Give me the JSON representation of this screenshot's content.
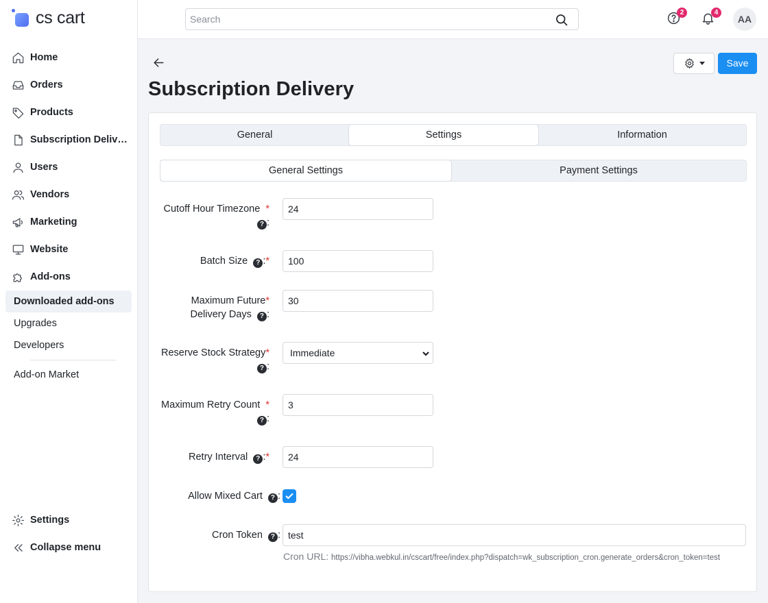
{
  "brand": {
    "name": "cs cart"
  },
  "search": {
    "placeholder": "Search"
  },
  "topbar": {
    "help_badge": "2",
    "notif_badge": "4",
    "avatar_initials": "AA"
  },
  "nav": {
    "items": [
      {
        "label": "Home",
        "icon": "home-icon"
      },
      {
        "label": "Orders",
        "icon": "inbox-icon"
      },
      {
        "label": "Products",
        "icon": "tag-icon"
      },
      {
        "label": "Subscription Delivery",
        "icon": "document-icon"
      },
      {
        "label": "Users",
        "icon": "user-icon"
      },
      {
        "label": "Vendors",
        "icon": "users-icon"
      },
      {
        "label": "Marketing",
        "icon": "megaphone-icon"
      },
      {
        "label": "Website",
        "icon": "monitor-icon"
      },
      {
        "label": "Add-ons",
        "icon": "puzzle-icon"
      }
    ],
    "addons_sub": [
      "Downloaded add-ons",
      "Upgrades",
      "Developers"
    ],
    "market": "Add-on Market",
    "settings": "Settings",
    "collapse": "Collapse menu"
  },
  "page": {
    "title": "Subscription Delivery",
    "save_label": "Save"
  },
  "tabs": [
    "General",
    "Settings",
    "Information"
  ],
  "subtabs": [
    "General Settings",
    "Payment Settings"
  ],
  "fields": {
    "cutoff_hour_timezone": {
      "label": "Cutoff Hour Timezone",
      "value": "24"
    },
    "batch_size": {
      "label": "Batch Size",
      "value": "100"
    },
    "max_future_days": {
      "label_line1": "Maximum Future",
      "label_line2": "Delivery Days",
      "value": "30"
    },
    "reserve_stock_strategy": {
      "label": "Reserve Stock Strategy",
      "value": "Immediate"
    },
    "max_retry_count": {
      "label": "Maximum Retry Count",
      "value": "3"
    },
    "retry_interval": {
      "label": "Retry Interval",
      "value": "24"
    },
    "allow_mixed_cart": {
      "label": "Allow Mixed Cart",
      "checked": true
    },
    "cron_token": {
      "label": "Cron Token",
      "value": "test"
    },
    "cron_url": {
      "label": "Cron URL:",
      "value": "https://vibha.webkul.in/cscart/free/index.php?dispatch=wk_subscription_cron.generate_orders&cron_token=test"
    }
  },
  "colors": {
    "accent": "#1b8ef2",
    "badge": "#e22a6e",
    "required": "#e0342f"
  }
}
